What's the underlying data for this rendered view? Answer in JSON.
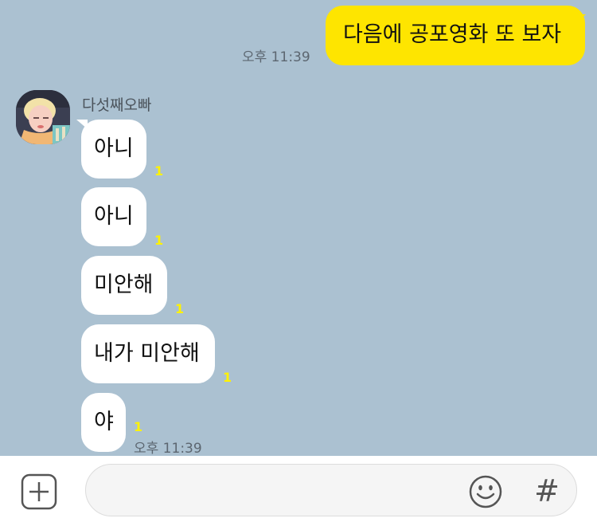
{
  "chat": {
    "outgoing": {
      "text": "다음에 공포영화 또 보자",
      "time": "오후 11:39"
    },
    "sender_name": "다섯째오빠",
    "incoming": [
      {
        "text": "아니",
        "unread": "1"
      },
      {
        "text": "아니",
        "unread": "1"
      },
      {
        "text": "미안해",
        "unread": "1"
      },
      {
        "text": "내가 미안해",
        "unread": "1"
      },
      {
        "text": "야",
        "unread": "1"
      }
    ],
    "last_time": "오후 11:39"
  },
  "input_bar": {
    "placeholder": "",
    "hash_label": "#",
    "icons": [
      "plus-icon",
      "emoji-icon",
      "hash-icon"
    ]
  },
  "colors": {
    "background": "#abc1d1",
    "outgoing_bubble": "#fee500",
    "incoming_bubble": "#ffffff",
    "unread": "#fff200"
  }
}
